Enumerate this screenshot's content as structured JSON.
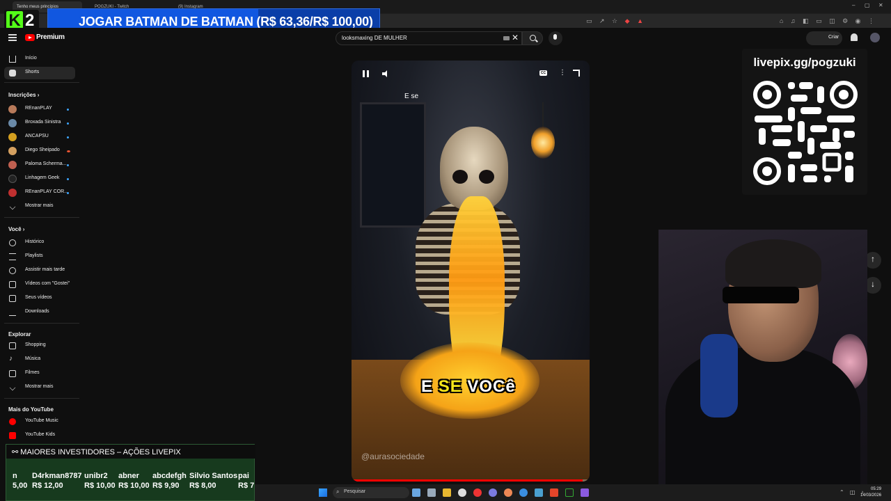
{
  "browser": {
    "tabs": [
      {
        "label": "Tenho meus princípios"
      },
      {
        "label": "POGZUKI - Twitch"
      },
      {
        "label": "(9) Instagram"
      }
    ],
    "window_controls": [
      "–",
      "▢",
      "✕"
    ]
  },
  "overlay": {
    "kick_logo_letter": "K",
    "kick_logo_number": "2",
    "goal_text": "JOGAR BATMAN DE BATMAN (R$ 63,36/R$ 100,00)",
    "goal_current": 63.36,
    "goal_target": 100.0,
    "goal_fraction": 0.6336,
    "qr_title": "livepix.gg/pogzuki"
  },
  "header": {
    "brand": "Premium",
    "search_value": "looksmaxing DE MULHER",
    "create_label": "Criar"
  },
  "sidebar": {
    "main": [
      {
        "label": "Início",
        "icon": "home-icon"
      },
      {
        "label": "Shorts",
        "icon": "shorts-icon",
        "active": true
      }
    ],
    "subscriptions_title": "Inscrições",
    "subscriptions": [
      {
        "label": "REnanPLAY",
        "color": "#b87a5a",
        "status": "new"
      },
      {
        "label": "Broxada Sinistra",
        "color": "#6a8aa8",
        "status": "new"
      },
      {
        "label": "ANCAPSU",
        "color": "#d4a020",
        "status": "new"
      },
      {
        "label": "Diego Sheipado",
        "color": "#d4a060",
        "status": "live"
      },
      {
        "label": "Paloma Scherma...",
        "color": "#c06050",
        "status": "new"
      },
      {
        "label": "Linhagem Geek",
        "color": "#222222",
        "status": "new"
      },
      {
        "label": "REnanPLAY COR...",
        "color": "#c03030",
        "status": "new"
      }
    ],
    "show_more": "Mostrar mais",
    "you_title": "Você",
    "you": [
      {
        "label": "Histórico",
        "icon": "history-icon"
      },
      {
        "label": "Playlists",
        "icon": "playlists-icon"
      },
      {
        "label": "Assistir mais tarde",
        "icon": "clock-icon"
      },
      {
        "label": "Vídeos com \"Gostei\"",
        "icon": "thumbs-up-icon"
      },
      {
        "label": "Seus vídeos",
        "icon": "your-videos-icon"
      },
      {
        "label": "Downloads",
        "icon": "download-icon"
      }
    ],
    "explore_title": "Explorar",
    "explore": [
      {
        "label": "Shopping",
        "icon": "shopping-icon"
      },
      {
        "label": "Música",
        "icon": "music-icon"
      },
      {
        "label": "Filmes",
        "icon": "film-icon"
      },
      {
        "label": "Mostrar mais",
        "icon": "chevron-down-icon"
      }
    ],
    "more_title": "Mais do YouTube",
    "more": [
      {
        "label": "YouTube Music",
        "icon": "youtube-music-icon"
      },
      {
        "label": "YouTube Kids",
        "icon": "youtube-kids-icon"
      }
    ]
  },
  "player": {
    "caption_top": "E se",
    "caption_main_1": "E",
    "caption_main_2": "SE",
    "caption_main_3": "VOCê",
    "watermark": "@aurasociedade",
    "progress_fraction": 0.97,
    "cc_label": "CC"
  },
  "investors": {
    "title": "MAIORES INVESTIDORES – AÇÕES LIVEPIX",
    "entries": [
      {
        "name": "n",
        "amount": "5,00"
      },
      {
        "name": "D4rkman8787",
        "amount": "R$ 12,00"
      },
      {
        "name": "unibr2",
        "amount": "R$ 10,00"
      },
      {
        "name": "abner",
        "amount": "R$ 10,00"
      },
      {
        "name": "abcdefgh",
        "amount": "R$ 9,90"
      },
      {
        "name": "Silvio Santos",
        "amount": "R$ 8,00"
      },
      {
        "name": "pai",
        "amount": "R$ 7"
      }
    ]
  },
  "taskbar": {
    "search_placeholder": "Pesquisar",
    "time": "05:29",
    "date": "14/03/2026"
  }
}
